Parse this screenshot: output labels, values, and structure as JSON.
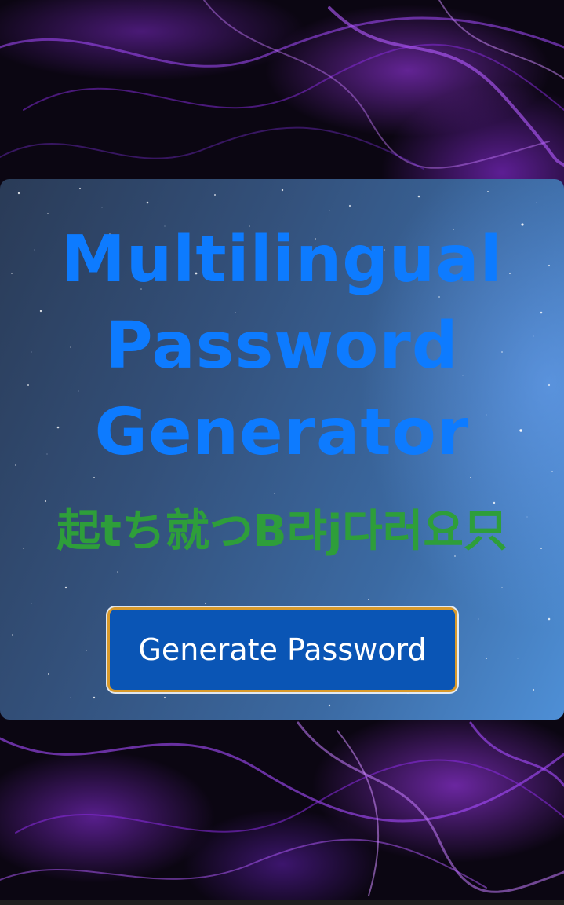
{
  "app": {
    "title": "Multilingual Password Generator"
  },
  "output": {
    "password": "起tち就つB랴j다러요只"
  },
  "actions": {
    "generate_label": "Generate Password"
  },
  "colors": {
    "title": "#0d7bff",
    "password": "#2e9e3a",
    "button_bg": "#0a55b5",
    "button_border": "#d99a2b",
    "background": "#0b0612",
    "smoke_accent": "#9b3cff"
  }
}
